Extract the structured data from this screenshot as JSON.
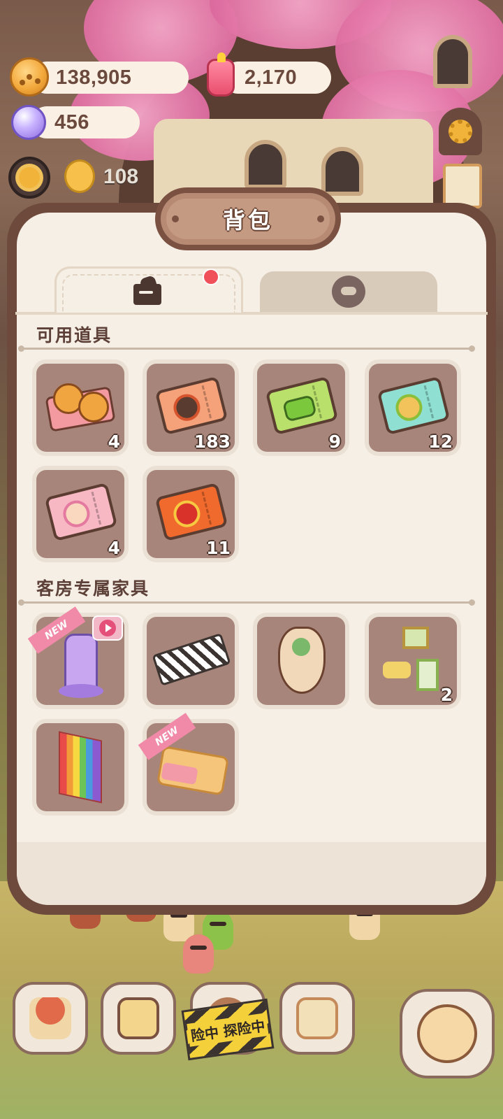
{
  "currencies": {
    "coins": "138,905",
    "jelly": "2,170",
    "crystals": "456"
  },
  "level": {
    "value": "108"
  },
  "panel": {
    "title": "背包",
    "tabs": [
      {
        "name": "items",
        "icon": "bag-icon",
        "active": true,
        "has_notification": true
      },
      {
        "name": "cookies",
        "icon": "cookie-face-icon",
        "active": false
      }
    ]
  },
  "sections": {
    "usable": {
      "title": "可用道具",
      "items": [
        {
          "icon": "cracker-snack-icon",
          "count": "4"
        },
        {
          "icon": "orange-ferris-ticket-icon",
          "count": "183"
        },
        {
          "icon": "green-car-ticket-icon",
          "count": "9"
        },
        {
          "icon": "teal-laurel-ticket-icon",
          "count": "12"
        },
        {
          "icon": "pink-character-ticket-icon",
          "count": "4"
        },
        {
          "icon": "red-lion-dance-ticket-icon",
          "count": "11"
        }
      ]
    },
    "furniture": {
      "title": "客房专属家具",
      "items": [
        {
          "icon": "purple-cat-tower-icon",
          "badge": "NEW",
          "video": true
        },
        {
          "icon": "zebra-rug-icon"
        },
        {
          "icon": "bird-kite-icon"
        },
        {
          "icon": "frame-shelf-decor-icon",
          "count": "2"
        },
        {
          "icon": "rainbow-flag-icon"
        },
        {
          "icon": "biscuit-bed-icon",
          "badge": "NEW"
        }
      ]
    }
  },
  "bottom_nav": {
    "buttons": [
      {
        "icon": "mushroom-house-icon"
      },
      {
        "icon": "clipboard-heart-icon"
      },
      {
        "icon": "adventure-icon",
        "banner": "险中 探险中"
      },
      {
        "icon": "furniture-shop-icon"
      },
      {
        "icon": "cat-fish-icon"
      }
    ]
  },
  "colors": {
    "panel_border": "#6e4a3c",
    "panel_bg": "#f6efe6",
    "cell_bg": "#a8857a",
    "badge_pink": "#f08aa8",
    "notification_red": "#f0505a"
  }
}
